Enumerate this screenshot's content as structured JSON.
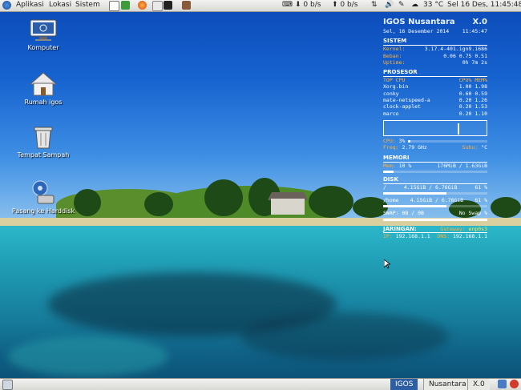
{
  "top_panel": {
    "menus": [
      "Aplikasi",
      "Lokasi",
      "Sistem"
    ],
    "net_down": "0 b/s",
    "net_up": "0 b/s",
    "temperature": "33 °C",
    "clock": "Sel 16 Des, 11:45:48"
  },
  "desktop_icons": [
    {
      "label": "Komputer",
      "icon": "computer-icon"
    },
    {
      "label": "Rumah igos",
      "icon": "home-folder-icon"
    },
    {
      "label": "Tempat Sampah",
      "icon": "trash-icon"
    },
    {
      "label": "Pasang ke Harddisk",
      "icon": "install-disk-icon"
    }
  ],
  "conky": {
    "title": "IGOS Nusantara",
    "version": "X.0",
    "date": "Sel, 16 Desember 2014",
    "time": "11:45:47",
    "sistem": {
      "heading": "SISTEM",
      "rows": [
        {
          "label": "Kernel:",
          "value": "3.17.4-401.ign9.i686"
        },
        {
          "label": "Beban:",
          "value": "0.06 0.75 0.51"
        },
        {
          "label": "Uptime:",
          "value": "0h 7m 2s"
        }
      ]
    },
    "prosesor": {
      "heading": "PROSESOR",
      "col_name": "TOP CPU",
      "col_values": "CPU% MEM%",
      "processes": [
        {
          "name": "Xorg.bin",
          "cpu": "1.00",
          "mem": "1.98"
        },
        {
          "name": "conky",
          "cpu": "0.60",
          "mem": "0.59"
        },
        {
          "name": "mate-netspeed-a",
          "cpu": "0.20",
          "mem": "1.26"
        },
        {
          "name": "clock-applet",
          "cpu": "0.20",
          "mem": "1.53"
        },
        {
          "name": "marco",
          "cpu": "0.20",
          "mem": "1.10"
        }
      ],
      "cpu_label": "CPU:",
      "cpu_value": "3%",
      "cpu_fraction": 0.03,
      "freq_label": "Freq:",
      "freq_value": "2.79 GHz",
      "temp_label": "Suhu:",
      "temp_value": "°C"
    },
    "memori": {
      "heading": "MEMORI",
      "label": "Mem:",
      "percent": "10 %",
      "value": "176MiB / 1.63GiB",
      "fraction": 0.1
    },
    "disk": {
      "heading": "DISK",
      "rows": [
        {
          "label": "/",
          "value": "4.15GiB / 6.76GiB",
          "percent": "61 %",
          "fraction": 0.61
        },
        {
          "label": "/home",
          "value": "4.15GiB / 6.76GiB",
          "percent": "61 %",
          "fraction": 0.61
        }
      ],
      "swap_label": "SWAP:",
      "swap_value": "0B / 0B",
      "swap_status": "No Swap %"
    },
    "jaringan": {
      "heading": "JARINGAN:",
      "gateway_label": "Gateway:",
      "gateway_value": "enp0s3",
      "ip_label": "IP:",
      "ip_value": "192.168.1.1",
      "dns_label": "DNS:",
      "dns_value": "192.168.1.1"
    }
  },
  "bottom_panel": {
    "workspaces": [
      "IGOS",
      "Nusantara",
      "X.0"
    ]
  },
  "colors": {
    "panel": "#e6e6e2",
    "accent_orange": "#ffb23a",
    "accent_yellow": "#ffe14a"
  }
}
